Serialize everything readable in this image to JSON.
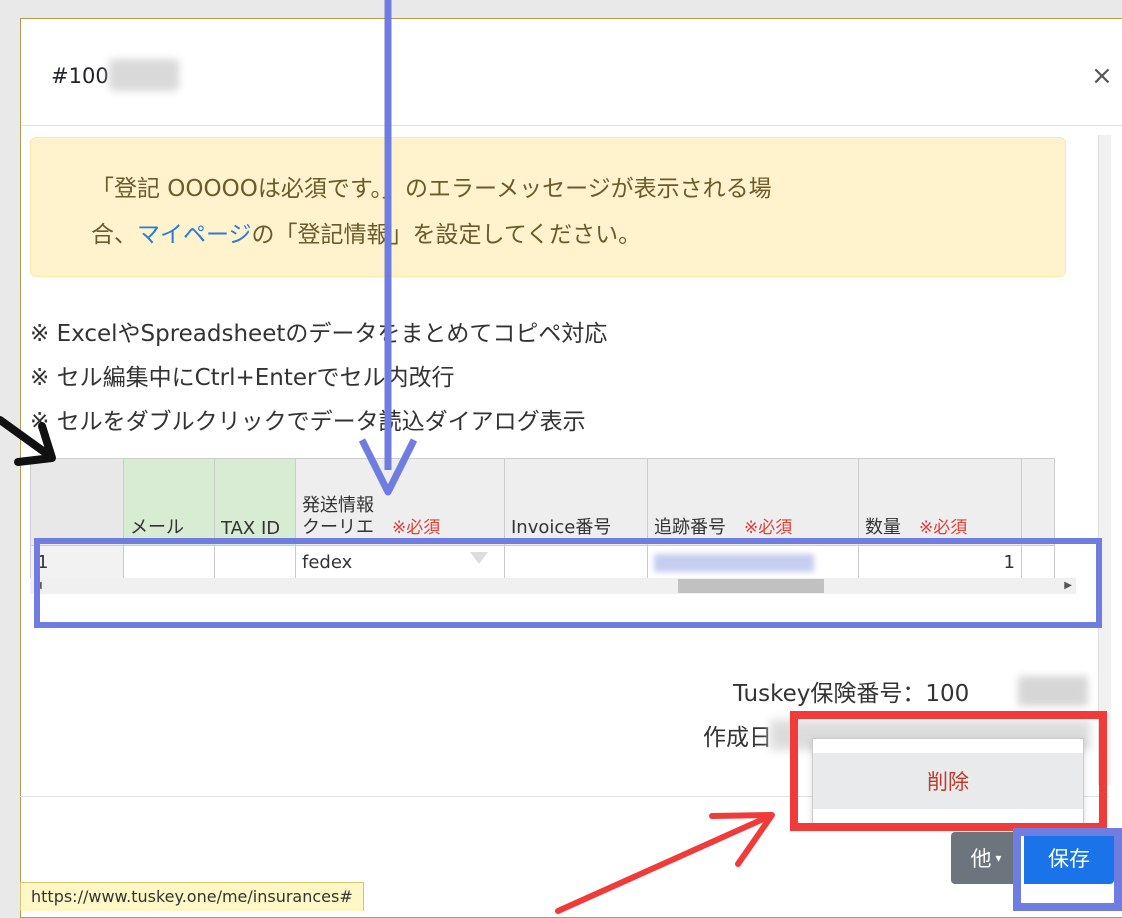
{
  "modal": {
    "title": "#100",
    "close_symbol": "×"
  },
  "alert": {
    "line1": "「登記 OOOOOは必須です。」のエラーメッセージが表示される場",
    "line2_prefix": "合、",
    "link_text": "マイページ",
    "line2_suffix": "の「登記情報」を設定してください。"
  },
  "notes": [
    "※ ExcelやSpreadsheetのデータをまとめてコピペ対応",
    "※ セル編集中にCtrl+Enterでセル内改行",
    "※ セルをダブルクリックでデータ読込ダイアログ表示"
  ],
  "grid": {
    "headers": {
      "mail": "メール",
      "tax_id": "TAX ID",
      "shipping_group": "発送情報",
      "courier": "クーリエ",
      "invoice": "Invoice番号",
      "tracking": "追跡番号",
      "quantity": "数量",
      "required": "※必須"
    },
    "row": {
      "index": "1",
      "courier": "fedex",
      "quantity": "1"
    }
  },
  "meta": {
    "insurance_label": "Tuskey保険番号：100",
    "created_label": "作成日"
  },
  "dropdown": {
    "delete_label": "削除"
  },
  "footer": {
    "other_label": "他",
    "save_label": "保存"
  },
  "status_url": "https://www.tuskey.one/me/insurances#",
  "colors": {
    "alert_bg": "#fff3cd",
    "link": "#2b7bd8",
    "required": "#e0403a",
    "primary": "#1a73e8",
    "secondary": "#6c757d",
    "annotation_blue": "#6f7de0",
    "annotation_red": "#f13a3a"
  }
}
